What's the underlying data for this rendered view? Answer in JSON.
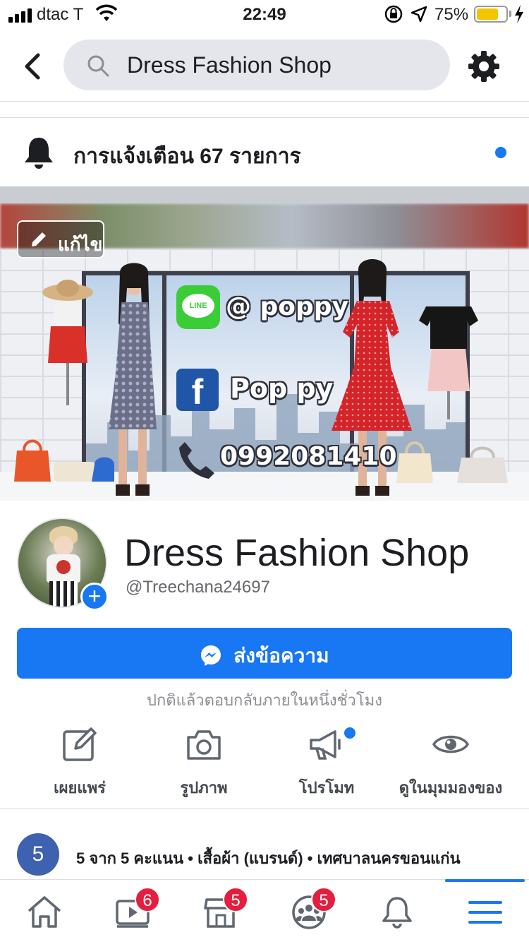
{
  "status_bar": {
    "carrier": "dtac T",
    "time": "22:49",
    "battery_percent": "75%",
    "battery_level": 0.75
  },
  "search": {
    "query": "Dress Fashion Shop",
    "icons": [
      "back-arrow-icon",
      "search-icon",
      "gear-icon"
    ]
  },
  "notifications": {
    "label": "การแจ้งเตือน 67 รายการ",
    "unread": true
  },
  "cover": {
    "edit_label": "แก้ไข",
    "line_id": "@ poppy",
    "facebook_name": "Pop py",
    "phone": "0992081410",
    "line_icon_text": "LINE"
  },
  "profile": {
    "name": "Dress Fashion Shop",
    "handle": "@Treechana24697"
  },
  "message_button": {
    "label": "ส่งข้อความ"
  },
  "reply_note": "ปกติแล้วตอบกลับภายในหนึ่งชั่วโมง",
  "actions": [
    {
      "label": "เผยแพร่",
      "icon": "compose-icon"
    },
    {
      "label": "รูปภาพ",
      "icon": "camera-icon"
    },
    {
      "label": "โปรโมท",
      "icon": "megaphone-icon"
    },
    {
      "label": "ดูในมุมมองของ",
      "icon": "eye-icon"
    }
  ],
  "rating": {
    "score": "5",
    "summary": "5 จาก 5 คะแนน • เสื้อผ้า (แบรนด์) • เทศบาลนครขอนแก่น"
  },
  "tab_bar": {
    "tabs": [
      {
        "name": "home",
        "badge": ""
      },
      {
        "name": "watch",
        "badge": "6"
      },
      {
        "name": "marketplace",
        "badge": "5"
      },
      {
        "name": "groups",
        "badge": "5"
      },
      {
        "name": "notifications",
        "badge": ""
      },
      {
        "name": "menu",
        "badge": ""
      }
    ],
    "active": "menu"
  },
  "colors": {
    "accent": "#1877f2",
    "badge": "#e41e3f",
    "battery": "#f5c400",
    "rating_badge": "#3e61b0"
  }
}
